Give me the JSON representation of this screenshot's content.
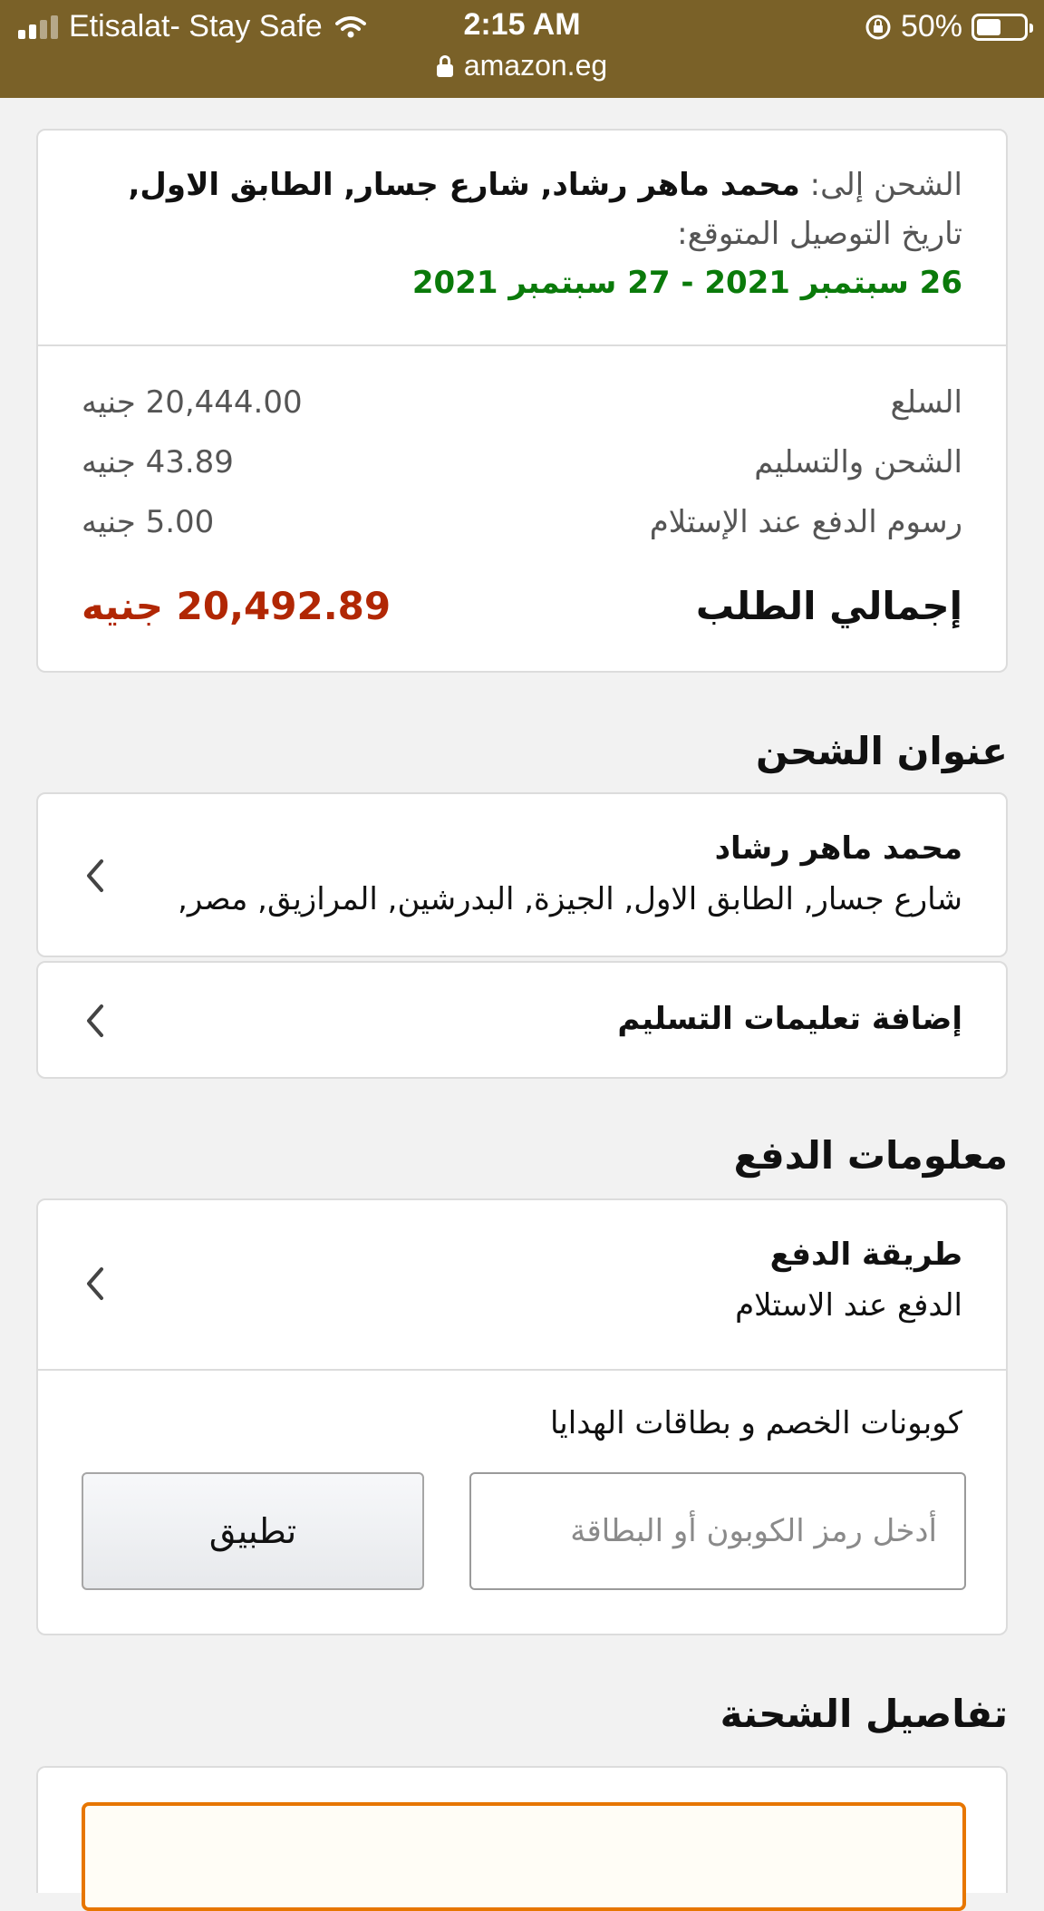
{
  "status_bar": {
    "carrier": "Etisalat- Stay Safe",
    "time": "2:15 AM",
    "battery": "50%",
    "battery_level": 0.5,
    "url": "amazon.eg",
    "signal_icon": "signal-icon",
    "wifi_icon": "wifi-icon",
    "lock_icon": "lock-icon"
  },
  "summary": {
    "ship_to_label": "الشحن إلى:",
    "ship_to_value": "محمد ماهر رشاد, شارع جسار, الطابق الاول,",
    "delivery_label": "تاريخ التوصيل المتوقع:",
    "delivery_range": "26 سبتمبر 2021 - 27 سبتمبر 2021",
    "rows": [
      {
        "label": "السلع",
        "value": "20,444.00 جنيه"
      },
      {
        "label": "الشحن والتسليم",
        "value": "43.89 جنيه"
      },
      {
        "label": "رسوم الدفع عند الإستلام",
        "value": "5.00 جنيه"
      }
    ],
    "total_label": "إجمالي الطلب",
    "total_value": "20,492.89 جنيه"
  },
  "shipping_address": {
    "section_title": "عنوان الشحن",
    "name": "محمد ماهر رشاد",
    "address": "شارع جسار, الطابق الاول, الجيزة, البدرشين, المرازيق, مصر,",
    "delivery_instructions": "إضافة تعليمات التسليم"
  },
  "payment": {
    "section_title": "معلومات الدفع",
    "method_label": "طريقة الدفع",
    "method_value": "الدفع عند الاستلام",
    "coupon_label": "كوبونات الخصم و بطاقات الهدايا",
    "coupon_placeholder": "أدخل رمز الكوبون أو البطاقة",
    "apply_button": "تطبيق"
  },
  "shipment": {
    "section_title": "تفاصيل الشحنة"
  },
  "colors": {
    "status_bar_bg": "#7a6128",
    "green": "#0a7a0a",
    "total_red": "#b12704",
    "shipment_border": "#e77600"
  }
}
